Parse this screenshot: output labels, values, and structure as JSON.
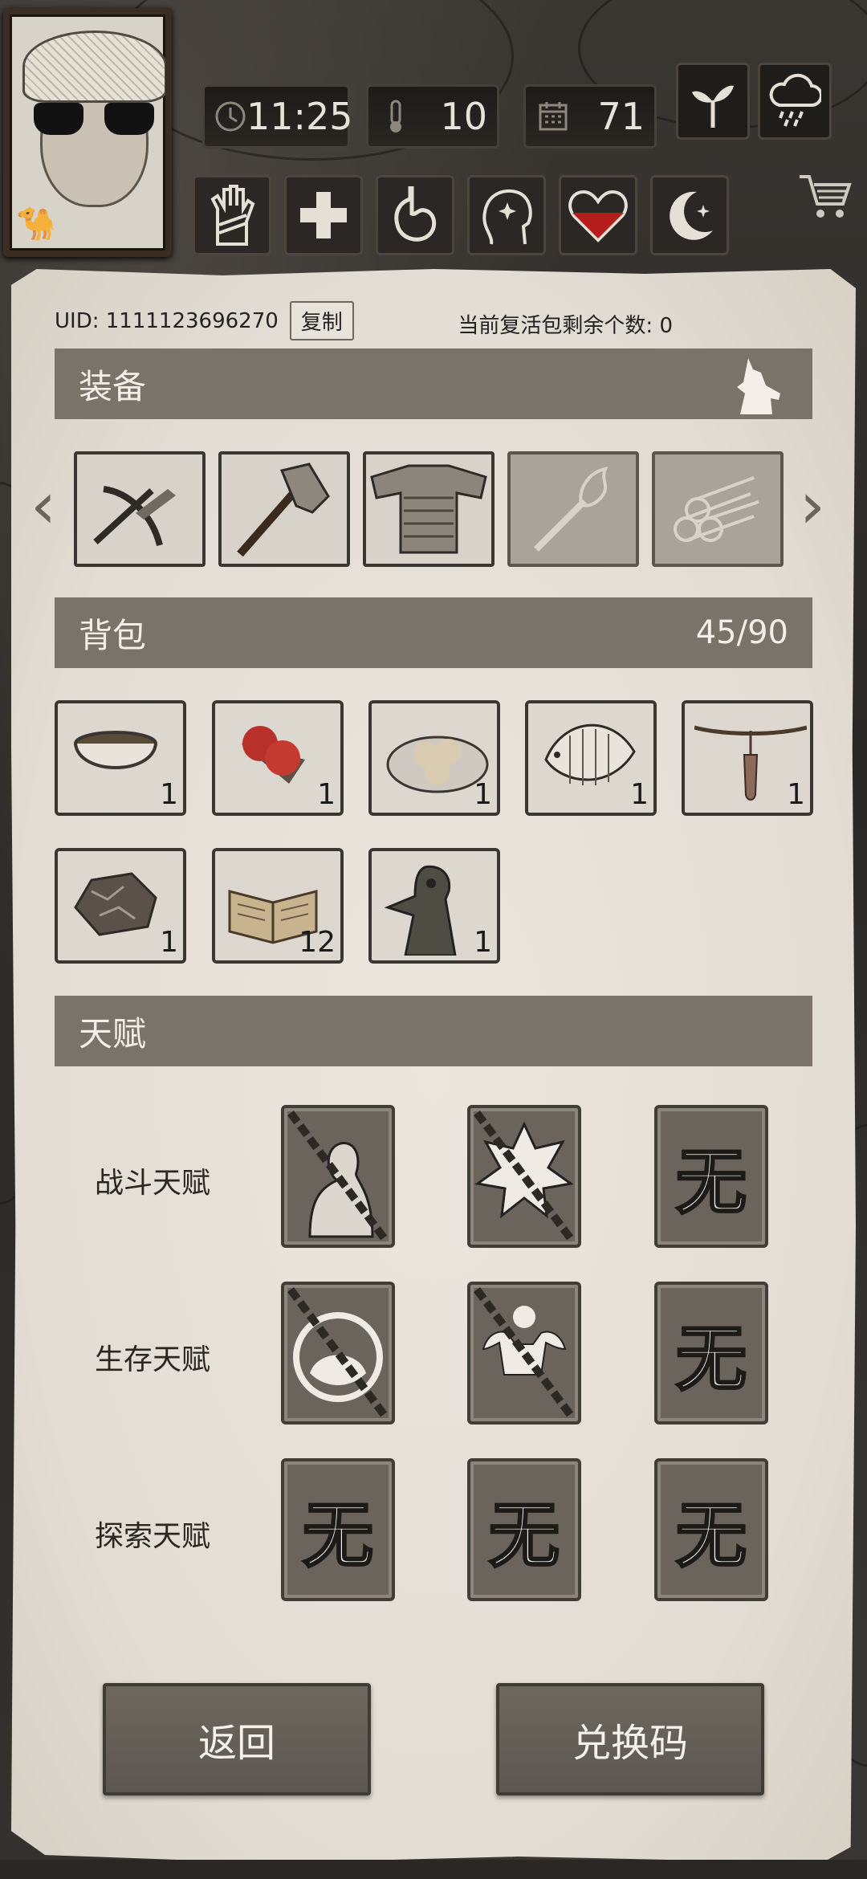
{
  "hud": {
    "time": "11:25",
    "temperature": "10",
    "day": "71"
  },
  "uid": {
    "label": "UID: 1111123696270",
    "copy_label": "复制",
    "revive_text": "当前复活包剩余个数: 0"
  },
  "equipment": {
    "title": "装备",
    "items": [
      {
        "icon": "crossbow-icon",
        "equipped": true
      },
      {
        "icon": "axe-icon",
        "equipped": true
      },
      {
        "icon": "armor-vest-icon",
        "equipped": true
      },
      {
        "icon": "torch-icon",
        "equipped": false
      },
      {
        "icon": "log-bundle-icon",
        "equipped": false
      }
    ]
  },
  "backpack": {
    "title": "背包",
    "capacity": "45/90",
    "items": [
      {
        "icon": "bowl-icon",
        "qty": "1"
      },
      {
        "icon": "berries-icon",
        "qty": "1"
      },
      {
        "icon": "dumplings-plate-icon",
        "qty": "1"
      },
      {
        "icon": "fish-icon",
        "qty": "1"
      },
      {
        "icon": "pendant-icon",
        "qty": "1"
      },
      {
        "icon": "ore-icon",
        "qty": "1"
      },
      {
        "icon": "book-icon",
        "qty": "12"
      },
      {
        "icon": "plague-doctor-icon",
        "qty": "1"
      }
    ]
  },
  "talents": {
    "title": "天赋",
    "none_label": "无",
    "rows": [
      {
        "label": "战斗天赋"
      },
      {
        "label": "生存天赋"
      },
      {
        "label": "探索天赋"
      }
    ]
  },
  "buttons": {
    "back": "返回",
    "redeem": "兑换码"
  },
  "colors": {
    "parchment": "#e6e1d9",
    "section_bar": "#7a736a",
    "talent_tile": "#6a645c",
    "button": "#625d56"
  }
}
